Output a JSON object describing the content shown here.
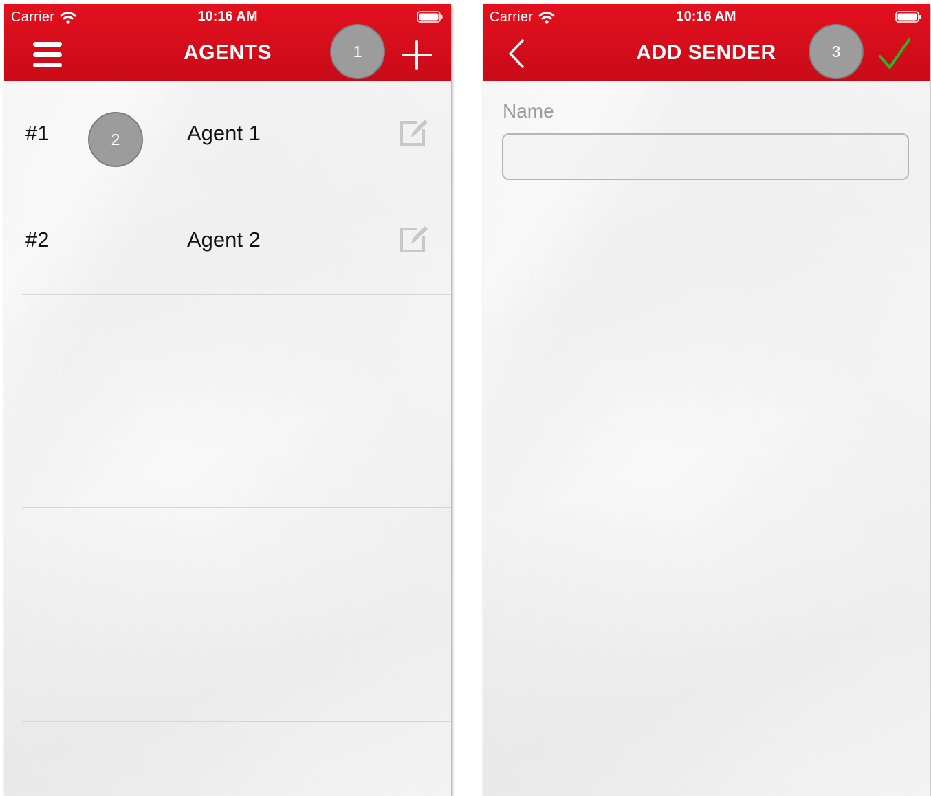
{
  "left_screen": {
    "status": {
      "carrier": "Carrier",
      "time": "10:16 AM"
    },
    "title": "AGENTS",
    "marker_add": "1",
    "marker_row": "2",
    "rows": [
      {
        "number": "#1",
        "name": "Agent 1"
      },
      {
        "number": "#2",
        "name": "Agent 2"
      }
    ]
  },
  "right_screen": {
    "status": {
      "carrier": "Carrier",
      "time": "10:16 AM"
    },
    "title": "ADD SENDER",
    "marker_save": "3",
    "name_label": "Name",
    "name_value": ""
  },
  "colors": {
    "nav_red": "#d30d1b",
    "checkmark_green": "#2bb52b",
    "marker_gray": "#9c9c9c"
  },
  "icons": {
    "menu": "hamburger-icon",
    "add": "plus-icon",
    "edit": "edit-icon",
    "back": "chevron-left-icon",
    "save": "checkmark-icon",
    "wifi": "wifi-icon",
    "battery": "battery-icon"
  }
}
